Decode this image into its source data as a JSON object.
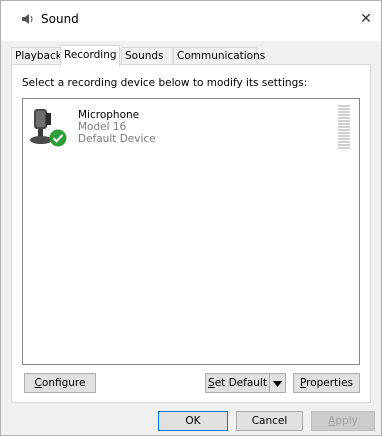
{
  "window": {
    "title": "Sound",
    "close_glyph": "✕"
  },
  "tabs": [
    {
      "label": "Playback",
      "active": false
    },
    {
      "label": "Recording",
      "active": true
    },
    {
      "label": "Sounds",
      "active": false
    },
    {
      "label": "Communications",
      "active": false
    }
  ],
  "panel": {
    "instruction": "Select a recording device below to modify its settings:",
    "devices": [
      {
        "name": "Microphone",
        "model": "Model 16",
        "status": "Default Device",
        "icon": "microphone-icon",
        "status_icon": "check-icon",
        "level_segments": 15
      }
    ]
  },
  "buttons": {
    "configure": {
      "first": "C",
      "rest": "onfigure"
    },
    "set_default": {
      "first": "S",
      "rest": "et Default"
    },
    "properties": {
      "first": "P",
      "rest": "roperties"
    },
    "ok": "OK",
    "cancel": "Cancel",
    "apply": {
      "first": "A",
      "rest": "pply"
    }
  },
  "colors": {
    "accent": "#0078d7",
    "check_green": "#2e9e3a",
    "disabled_text": "#a0a0a0"
  }
}
